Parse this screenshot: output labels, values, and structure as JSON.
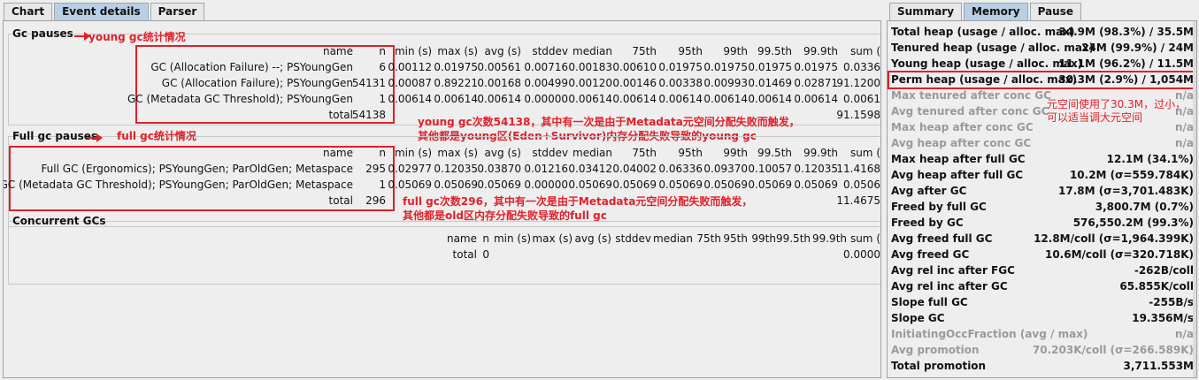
{
  "left_tabs": [
    {
      "label": "Chart",
      "active": false
    },
    {
      "label": "Event details",
      "active": true
    },
    {
      "label": "Parser",
      "active": false
    }
  ],
  "right_tabs": [
    {
      "label": "Summary",
      "active": false
    },
    {
      "label": "Memory",
      "active": true
    },
    {
      "label": "Pause",
      "active": false
    }
  ],
  "columns": [
    "name",
    "n",
    "min (s)",
    "max (s)",
    "avg (s)",
    "stddev",
    "median",
    "75th",
    "95th",
    "99th",
    "99.5th",
    "99.9th",
    "sum ("
  ],
  "gc_pauses": {
    "title": "Gc pauses",
    "rows": [
      {
        "name": "GC (Allocation Failure) --; PSYoungGen",
        "n": "6",
        "min": "0.00112",
        "max": "0.01975",
        "avg": "0.00561",
        "stddev": "0.00716",
        "median": "0.00183",
        "p75": "0.00610",
        "p95": "0.01975",
        "p99": "0.01975",
        "p995": "0.01975",
        "p999": "0.01975",
        "sum": "0.0336"
      },
      {
        "name": "GC (Allocation Failure); PSYoungGen",
        "n": "54131",
        "min": "0.00087",
        "max": "0.89221",
        "avg": "0.00168",
        "stddev": "0.00499",
        "median": "0.00120",
        "p75": "0.00146",
        "p95": "0.00338",
        "p99": "0.00993",
        "p995": "0.01469",
        "p999": "0.02871",
        "sum": "91.1200"
      },
      {
        "name": "GC (Metadata GC Threshold); PSYoungGen",
        "n": "1",
        "min": "0.00614",
        "max": "0.00614",
        "avg": "0.00614",
        "stddev": "0.00000",
        "median": "0.00614",
        "p75": "0.00614",
        "p95": "0.00614",
        "p99": "0.00614",
        "p995": "0.00614",
        "p999": "0.00614",
        "sum": "0.0061"
      }
    ],
    "total_label": "total",
    "total_n": "54138",
    "total_sum": "91.1598"
  },
  "full_gc_pauses": {
    "title": "Full gc pauses",
    "rows": [
      {
        "name": "Full GC (Ergonomics); PSYoungGen; ParOldGen; Metaspace",
        "n": "295",
        "min": "0.02977",
        "max": "0.12035",
        "avg": "0.03870",
        "stddev": "0.01216",
        "median": "0.03412",
        "p75": "0.04002",
        "p95": "0.06336",
        "p99": "0.09370",
        "p995": "0.10057",
        "p999": "0.12035",
        "sum": "11.4168"
      },
      {
        "name": "Full GC (Metadata GC Threshold); PSYoungGen; ParOldGen; Metaspace",
        "n": "1",
        "min": "0.05069",
        "max": "0.05069",
        "avg": "0.05069",
        "stddev": "0.00000",
        "median": "0.05069",
        "p75": "0.05069",
        "p95": "0.05069",
        "p99": "0.05069",
        "p995": "0.05069",
        "p999": "0.05069",
        "sum": "0.0506"
      }
    ],
    "total_label": "total",
    "total_n": "296",
    "total_sum": "11.4675"
  },
  "concurrent_gcs": {
    "title": "Concurrent GCs",
    "total_label": "total",
    "total_n": "0",
    "total_sum": "0.0000"
  },
  "annotations": {
    "young_gc_label": "young gc统计情况",
    "full_gc_label": "full gc统计情况",
    "young_note_1": "young gc次数54138，其中有一次是由于Metadata元空间分配失败而触发，",
    "young_note_2": "其他都是young区(Eden+Survivor)内存分配失败导致的young gc",
    "full_note_1": "full gc次数296，其中有一次是由于Metadata元空间分配失败而触发，",
    "full_note_2": "其他都是old区内存分配失败导致的full gc",
    "perm_note_1": "元空间使用了30.3M，过小，",
    "perm_note_2": "可以适当调大元空间",
    "color": "#e0202a"
  },
  "memory": [
    {
      "label": "Total heap (usage / alloc. max)",
      "value": "34.9M (98.3%) / 35.5M",
      "dim": false
    },
    {
      "label": "Tenured heap (usage / alloc. max)",
      "value": "24M (99.9%) / 24M",
      "dim": false
    },
    {
      "label": "Young heap (usage / alloc. max)",
      "value": "11.1M (96.2%) / 11.5M",
      "dim": false
    },
    {
      "label": "Perm heap (usage / alloc. max)",
      "value": "30.3M (2.9%) / 1,054M",
      "dim": false
    },
    {
      "label": "Max tenured after conc GC",
      "value": "n/a",
      "dim": true
    },
    {
      "label": "Avg tenured after conc GC",
      "value": "n/a",
      "dim": true
    },
    {
      "label": "Max heap after conc GC",
      "value": "n/a",
      "dim": true
    },
    {
      "label": "Avg heap after conc GC",
      "value": "n/a",
      "dim": true
    },
    {
      "label": "Max heap after full GC",
      "value": "12.1M (34.1%)",
      "dim": false
    },
    {
      "label": "Avg heap after full GC",
      "value": "10.2M (σ=559.784K)",
      "dim": false
    },
    {
      "label": "Avg after GC",
      "value": "17.8M (σ=3,701.483K)",
      "dim": false
    },
    {
      "label": "Freed by full GC",
      "value": "3,800.7M (0.7%)",
      "dim": false
    },
    {
      "label": "Freed by GC",
      "value": "576,550.2M (99.3%)",
      "dim": false
    },
    {
      "label": "Avg freed full GC",
      "value": "12.8M/coll (σ=1,964.399K)",
      "dim": false
    },
    {
      "label": "Avg freed GC",
      "value": "10.6M/coll (σ=320.718K)",
      "dim": false
    },
    {
      "label": "Avg rel inc after FGC",
      "value": "-262B/coll",
      "dim": false
    },
    {
      "label": "Avg rel inc after GC",
      "value": "65.855K/coll",
      "dim": false
    },
    {
      "label": "Slope full GC",
      "value": "-255B/s",
      "dim": false
    },
    {
      "label": "Slope GC",
      "value": "19.356M/s",
      "dim": false
    },
    {
      "label": "InitiatingOccFraction (avg / max)",
      "value": "n/a",
      "dim": true
    },
    {
      "label": "Avg promotion",
      "value": "70.203K/coll (σ=266.589K)",
      "dim": true
    },
    {
      "label": "Total promotion",
      "value": "3,711.553M",
      "dim": false
    }
  ]
}
